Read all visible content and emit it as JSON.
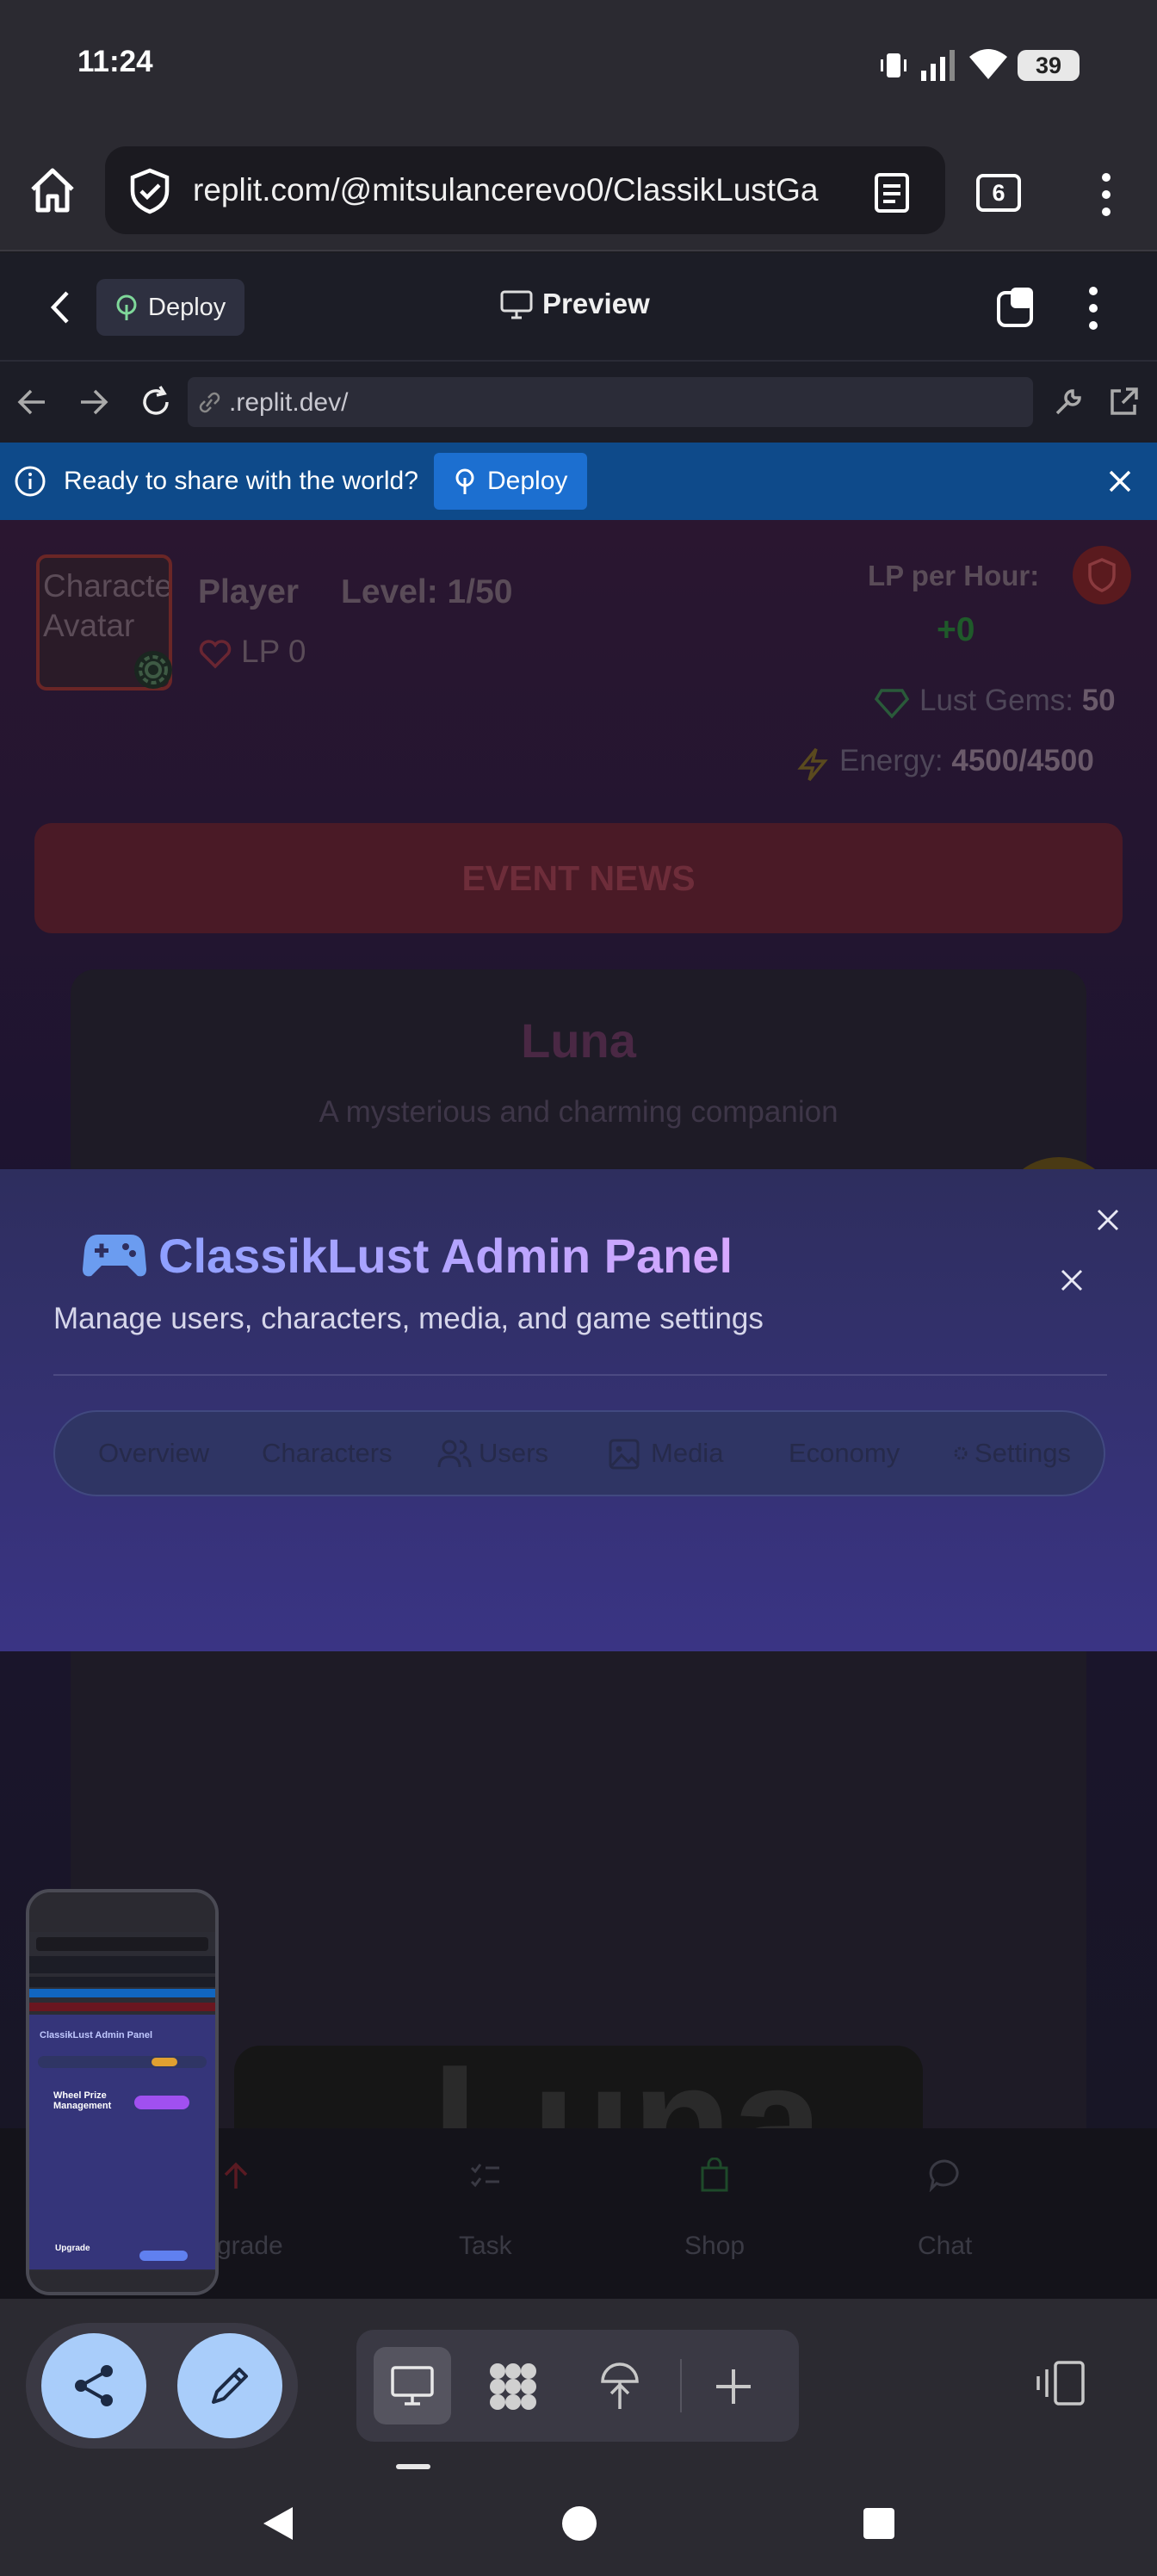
{
  "status_bar": {
    "time": "11:24",
    "battery": "39"
  },
  "browser": {
    "url": "replit.com/@mitsulancerevo0/ClassikLustGa",
    "tab_count": "6"
  },
  "replit": {
    "deploy_label": "Deploy",
    "preview_label": "Preview",
    "dev_url": ".replit.dev/"
  },
  "banner": {
    "text": "Ready to share with the world?",
    "button": "Deploy"
  },
  "game": {
    "avatar_text_1": "Characte",
    "avatar_text_2": "Avatar",
    "player_name": "Player",
    "level": "Level: 1/50",
    "lp": "LP 0",
    "lp_per_hour_label": "LP per Hour:",
    "lp_per_hour_value": "+0",
    "gems_label": "Lust Gems:",
    "gems_value": "50",
    "energy_label": "Energy:",
    "energy_value": "4500/4500",
    "event_news": "EVENT NEWS",
    "character_name": "Luna",
    "character_desc": "A mysterious and charming companion",
    "big_name": "Luna",
    "nav": {
      "upgrade": "grade",
      "task": "Task",
      "shop": "Shop",
      "chat": "Chat"
    }
  },
  "admin": {
    "title": "ClassikLust Admin Panel",
    "subtitle": "Manage users, characters, media, and game settings",
    "tabs": [
      "Overview",
      "Characters",
      "Users",
      "Media",
      "Economy",
      "Settings"
    ]
  },
  "thumbnail": {
    "title": "ClassikLust Admin Panel",
    "item1": "Wheel Prize Management",
    "item2": "Upgrade"
  },
  "colors": {
    "accent_blue": "#a9cdfa",
    "banner_blue": "#0e4a8a",
    "modal_purple": "#3a3484"
  }
}
